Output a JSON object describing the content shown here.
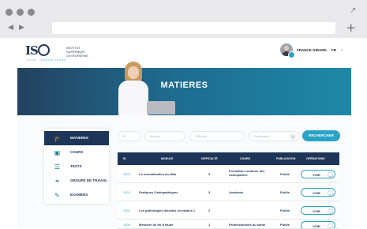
{
  "browser": {
    "window_dot_color": "#8a8a8f",
    "expand_icon": "↗",
    "back_icon": "◀",
    "forward_icon": "▶",
    "new_tab_icon": "+"
  },
  "header": {
    "logo": {
      "mark": "IS",
      "line1": "INSTITUT",
      "line2": "SUPÉRIEUR",
      "line3": "OSTÉOPATHIE",
      "tagline": "LYON · RHÔNE-ALPES"
    },
    "user_name": "FRANCE GIRARD",
    "language": "FR",
    "language_chevron": "⌄"
  },
  "hero": {
    "title": "MATIERES"
  },
  "sidebar": {
    "items": [
      {
        "label": "MATIERES",
        "icon": "graduation-cap-icon",
        "glyph": "🎓"
      },
      {
        "label": "COURS",
        "icon": "presentation-icon",
        "glyph": "▣"
      },
      {
        "label": "TESTS",
        "icon": "checklist-icon",
        "glyph": "☰"
      },
      {
        "label": "GROUPE DE TRAVAIL",
        "icon": "group-icon",
        "glyph": "⚭"
      },
      {
        "label": "EXAMENS",
        "icon": "exam-icon",
        "glyph": "✎"
      }
    ]
  },
  "filters": {
    "id_placeholder": "ID",
    "module_placeholder": "Module",
    "difficulte_placeholder": "Difficulté",
    "publication_placeholder": "Publication",
    "dropdown_chevron": "⌄",
    "search_label": "RECHERCHER"
  },
  "table": {
    "headers": [
      "ID",
      "MODULE",
      "DIFFICULTÉ",
      "COURS",
      "PUBLICATION",
      "OPÉRATIONS"
    ],
    "rows": [
      {
        "id": "1575",
        "module": "La normalisation du tibia",
        "difficulte": "3",
        "cours": "Formation continue des\nostéopathes",
        "publication": "Publié",
        "action": "VOIR"
      },
      {
        "id": "1574",
        "module": "Pratiques Ostéopathiques",
        "difficulte": "3",
        "cours": "Anatomie",
        "publication": "Publié",
        "action": "VOIR"
      },
      {
        "id": "1541",
        "module": "Les pathologies discales cervicales 1",
        "difficulte": "2",
        "cours": "",
        "publication": "Publié",
        "action": "VOIR"
      },
      {
        "id": "1538",
        "module": "Mémoire de fin d'étude",
        "difficulte": "1",
        "cours": "Professionnels du santé",
        "publication": "Publié",
        "action": "VOIR"
      }
    ],
    "action_chevron": "⌄"
  },
  "colors": {
    "navy": "#1d3557",
    "accent": "#2aa4c6"
  }
}
